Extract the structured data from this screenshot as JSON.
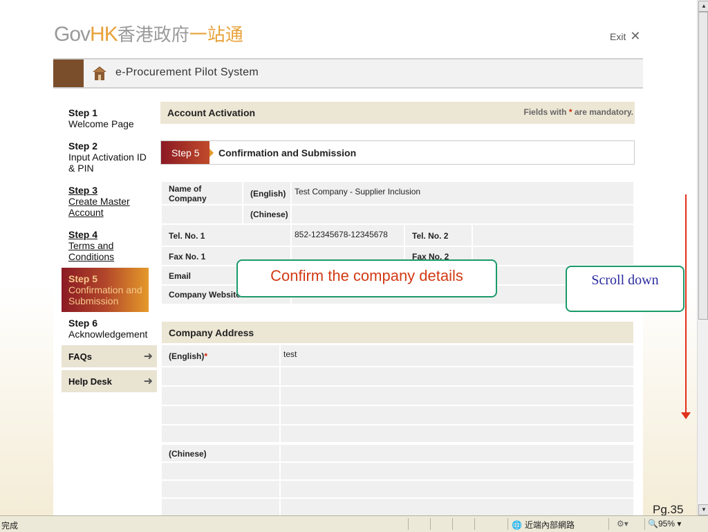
{
  "header": {
    "logo_gov": "Gov",
    "logo_hk": "HK",
    "logo_zh_grey": "香港政府",
    "logo_zh_orange": "一站通",
    "exit_label": "Exit",
    "system_title": "e-Procurement Pilot System"
  },
  "nav": {
    "steps": [
      {
        "num": "Step 1",
        "label": "Welcome Page"
      },
      {
        "num": "Step 2",
        "label1": "Input Activation ID",
        "label2": "& PIN"
      },
      {
        "num": "Step 3",
        "label1": "Create Master",
        "label2": "Account"
      },
      {
        "num": "Step 4",
        "label1": "Terms and",
        "label2": "Conditions"
      },
      {
        "num": "Step 5",
        "label1": "Confirmation and",
        "label2": "Submission"
      },
      {
        "num": "Step 6",
        "label": "Acknowledgement"
      }
    ],
    "faqs": "FAQs",
    "helpdesk": "Help Desk"
  },
  "main": {
    "section_title": "Account Activation",
    "mandatory_prefix": "Fields with ",
    "mandatory_star": "*",
    "mandatory_suffix": " are mandatory.",
    "step_badge": "Step 5",
    "step_title": "Confirmation and Submission",
    "company": {
      "name_label1": "Name of",
      "name_label2": "Company",
      "english_label": "(English)",
      "chinese_label": "(Chinese)",
      "name_english": "Test Company - Supplier Inclusion",
      "tel1_label": "Tel. No. 1",
      "tel1_value": "852-12345678-12345678",
      "tel2_label": "Tel. No. 2",
      "fax1_label": "Fax No. 1",
      "fax2_label": "Fax No. 2",
      "email_label": "Email",
      "website_label": "Company Website"
    },
    "address": {
      "title": "Company Address",
      "english_label": "(English)",
      "english_star": "*",
      "english_value": "test",
      "chinese_label": "(Chinese)"
    }
  },
  "annotations": {
    "confirm": "Confirm the company details",
    "scroll": "Scroll down",
    "page": "Pg.35"
  },
  "statusbar": {
    "done": "完成",
    "zone": "近端內部網路",
    "zoom": "95%"
  },
  "colors": {
    "accent_orange": "#e8a23a",
    "brown": "#7a4e2b",
    "beige": "#ece6d4",
    "callout_border": "#1a9a6a",
    "callout_text_red": "#d23a14",
    "arrow_red": "#e0301a"
  }
}
